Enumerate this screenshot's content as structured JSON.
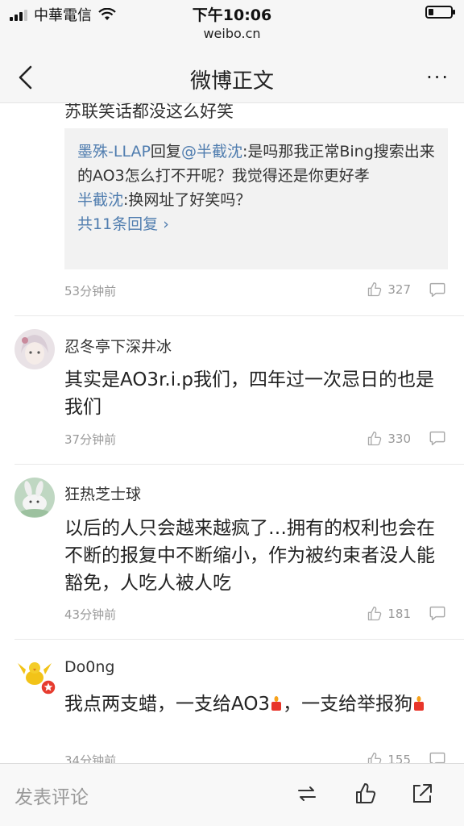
{
  "status_bar": {
    "carrier": "中華電信",
    "time": "下午10:06",
    "url": "weibo.cn"
  },
  "nav": {
    "title": "微博正文",
    "more": "···"
  },
  "previous_comment": {
    "tail_text": "苏联笑话都没这么好笑",
    "replies": [
      {
        "user": "墨殊-LLAP",
        "reply_word": "回复",
        "target": "@半截沈",
        "text": ":是吗那我正常Bing搜索出来的AO3怎么打不开呢？我觉得还是你更好孝"
      },
      {
        "user": "半截沈",
        "text": ":换网址了好笑吗？"
      }
    ],
    "more_replies": "共11条回复",
    "time": "53分钟前",
    "likes": "327"
  },
  "comments": [
    {
      "username": "忍冬亭下深井冰",
      "text": "其实是AO3r.i.p我们，四年过一次忌日的也是我们",
      "time": "37分钟前",
      "likes": "330"
    },
    {
      "username": "狂热芝士球",
      "text": "以后的人只会越来越疯了…拥有的权利也会在不断的报复中不断缩小，作为被约束者没人能豁免，人吃人被人吃",
      "time": "43分钟前",
      "likes": "181"
    },
    {
      "username": "Do0ng",
      "text_a": "我点两支蜡，一支给AO3",
      "text_b": "，一支给举报狗",
      "time": "34分钟前",
      "likes": "155"
    }
  ],
  "bottom_bar": {
    "input_placeholder": "发表评论"
  },
  "colors": {
    "link": "#507daf",
    "meta": "#999999",
    "bar_bg": "#f6f6f6"
  },
  "icons": [
    "signal-icon",
    "wifi-icon",
    "battery-icon",
    "back-arrow-icon",
    "more-icon",
    "thumb-up-icon",
    "comment-bubble-icon",
    "repost-icon",
    "share-icon",
    "candle-icon",
    "verified-badge-icon"
  ]
}
